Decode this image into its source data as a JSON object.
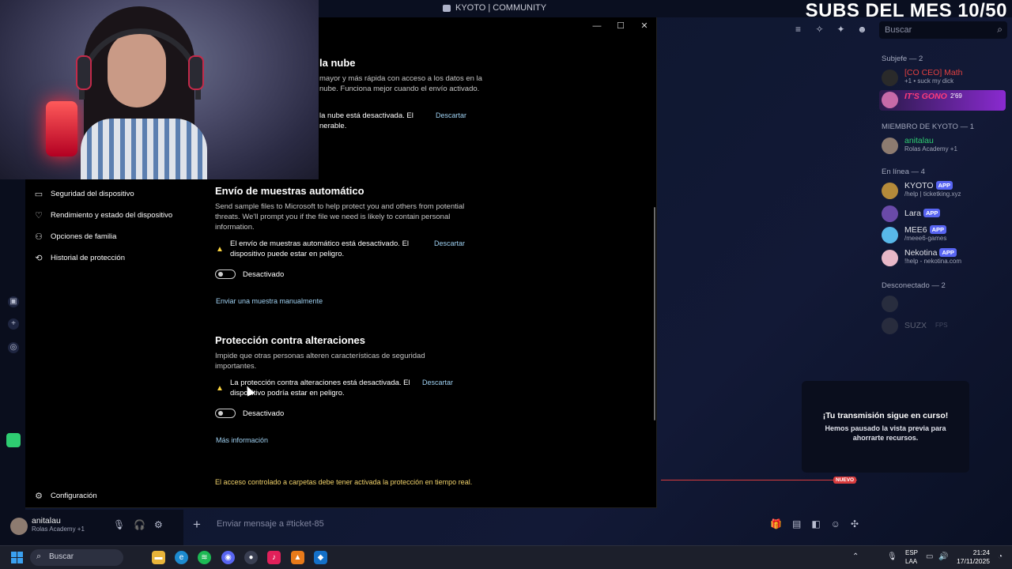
{
  "discord": {
    "window_title": "KYOTO | COMMUNITY",
    "banner": "SUBS DEL MES 10/50",
    "search_placeholder": "Buscar",
    "member_groups": {
      "subjefe": "Subjefe — 2",
      "miembro": "MIEMBRO DE KYOTO — 1",
      "en_linea": "En línea — 4",
      "desconectado": "Desconectado — 2"
    },
    "members": [
      {
        "name": "[CO CEO] Math",
        "sub": "+1 • suck my dick",
        "color": "#e04040"
      },
      {
        "name": "IT'S GONO",
        "sub": "",
        "tag": "2'69",
        "color": "#ff3b7a"
      },
      {
        "name": "anitalau",
        "sub": "Rolas Academy +1",
        "color": "#2ecc71"
      },
      {
        "name": "KYOTO",
        "sub": "/help | ticketking.xyz",
        "app": "APP"
      },
      {
        "name": "Lara",
        "sub": "",
        "app": "APP"
      },
      {
        "name": "MEE6",
        "sub": "/meee6-games",
        "app": "APP"
      },
      {
        "name": "Nekotina",
        "sub": "!help - nekotina.com",
        "app": "APP"
      },
      {
        "name": "SUZX",
        "sub": "",
        "tag": "FPS"
      }
    ],
    "notice": {
      "title": "¡Tu transmisión sigue en curso!",
      "body": "Hemos pausado la vista previa para ahorrarte recursos."
    },
    "new_badge": "NUEVO",
    "user": {
      "name": "anitalau",
      "sub": "Rolas Academy +1"
    },
    "message_placeholder": "Enviar mensaje a #ticket-85"
  },
  "winsec": {
    "nav": [
      {
        "label": "Seguridad del dispositivo",
        "icon": "monitor-icon"
      },
      {
        "label": "Rendimiento y estado del dispositivo",
        "icon": "heart-icon"
      },
      {
        "label": "Opciones de familia",
        "icon": "family-icon"
      },
      {
        "label": "Historial de protección",
        "icon": "history-icon"
      }
    ],
    "settings_label": "Configuración",
    "cloud": {
      "heading": "la nube",
      "desc": "mayor y más rápida con acceso a los datos en la nube. Funciona mejor cuando el envío activado.",
      "warn": "la nube está desactivada. El nerable.",
      "dismiss": "Descartar"
    },
    "samples": {
      "heading": "Envío de muestras automático",
      "desc": "Send sample files to Microsoft to help protect you and others from potential threats. We'll prompt you if the file we need is likely to contain personal information.",
      "warn": "El envío de muestras automático está desactivado. El dispositivo puede estar en peligro.",
      "dismiss": "Descartar",
      "toggle_label": "Desactivado",
      "link": "Enviar una muestra manualmente"
    },
    "tamper": {
      "heading": "Protección contra alteraciones",
      "desc": "Impide que otras personas alteren características de seguridad importantes.",
      "warn": "La protección contra alteraciones está desactivada. El dispositivo podría estar en peligro.",
      "dismiss": "Descartar",
      "toggle_label": "Desactivado",
      "link": "Más información"
    },
    "folder_note": "El acceso controlado a carpetas debe tener activada la protección en tiempo real."
  },
  "taskbar": {
    "search_placeholder": "Buscar",
    "lang_line1": "ESP",
    "lang_line2": "LAA",
    "time": "21:24",
    "date": "17/11/2025"
  }
}
